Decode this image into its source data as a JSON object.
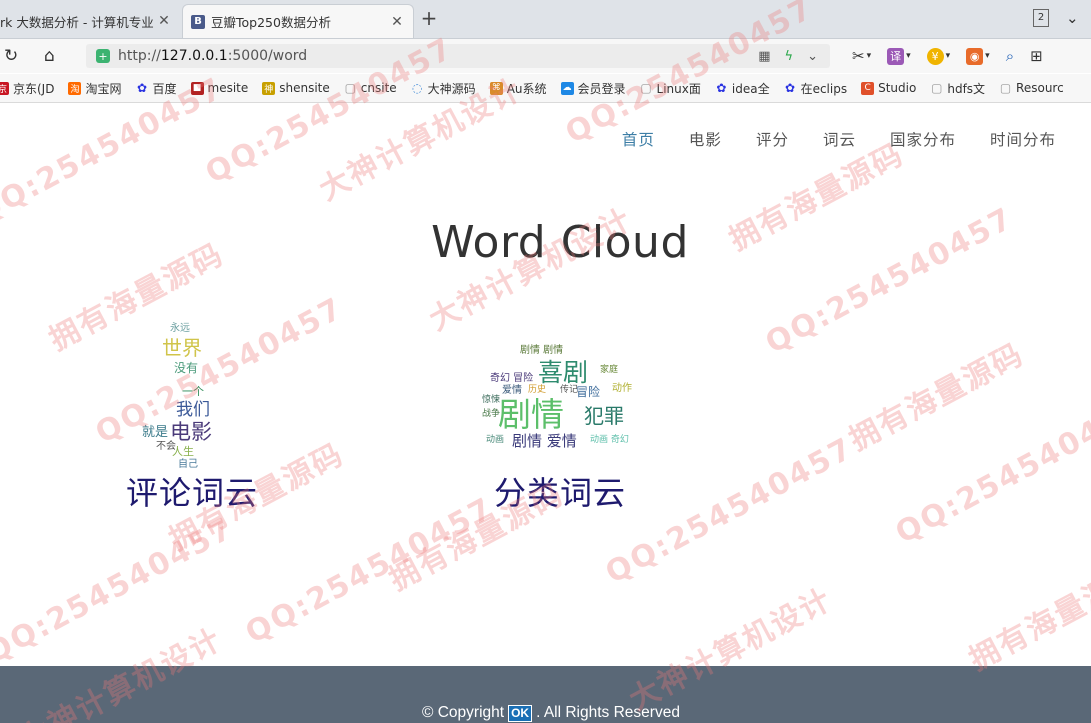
{
  "browser": {
    "tabs": [
      {
        "title": "rk 大数据分析 - 计算机专业",
        "active": false
      },
      {
        "title": "豆瓣Top250数据分析",
        "active": true,
        "favicon": "B"
      }
    ],
    "tab_count": "2",
    "url_prefix": "http://",
    "url_host": "127.0.0.1",
    "url_path": ":5000/word",
    "bookmarks": [
      {
        "label": "京东(JD",
        "icon": "jd-icon",
        "color": "#c81623"
      },
      {
        "label": "淘宝网",
        "icon": "taobao-icon",
        "color": "#ff6a00"
      },
      {
        "label": "百度",
        "icon": "baidu-paw-icon",
        "color": "#2932e1"
      },
      {
        "label": "mesite",
        "icon": "mesite-icon",
        "color": "#b22222"
      },
      {
        "label": "shensite",
        "icon": "shensite-icon",
        "color": "#c8a000"
      },
      {
        "label": "cnsite",
        "icon": "page-icon",
        "color": "#999999"
      },
      {
        "label": "大神源码",
        "icon": "globe-icon",
        "color": "#4a90d9"
      },
      {
        "label": "Au系统",
        "icon": "au-icon",
        "color": "#d98b2a"
      },
      {
        "label": "会员登录",
        "icon": "cloud-icon",
        "color": "#1e88e5"
      },
      {
        "label": "Linux面",
        "icon": "page-icon",
        "color": "#999999"
      },
      {
        "label": "idea全",
        "icon": "baidu-paw-icon",
        "color": "#2932e1"
      },
      {
        "label": "在eclips",
        "icon": "baidu-paw-icon",
        "color": "#2932e1"
      },
      {
        "label": "Studio",
        "icon": "studio-icon",
        "color": "#e0502a"
      },
      {
        "label": "hdfs文",
        "icon": "page-icon",
        "color": "#999999"
      },
      {
        "label": "Resourc",
        "icon": "page-icon",
        "color": "#999999"
      }
    ]
  },
  "nav": {
    "items": [
      "首页",
      "电影",
      "评分",
      "词云",
      "国家分布",
      "时间分布"
    ],
    "active_index": 0
  },
  "page_title": "Word Cloud",
  "clouds": [
    {
      "caption": "评论词云",
      "words": [
        "永远",
        "世界",
        "我们",
        "电影",
        "就是",
        "不会",
        "人生",
        "自己",
        "一个",
        "没有"
      ]
    },
    {
      "caption": "分类词云",
      "words": [
        "剧情 剧情",
        "喜剧",
        "奇幻 冒险",
        "剧情",
        "犯罪",
        "冒险",
        "爱情",
        "剧情 爱情",
        "动画",
        "动作",
        "传记",
        "惊悚",
        "战争",
        "家庭",
        "历史",
        "动画 奇幻"
      ]
    }
  ],
  "footer": {
    "before": "© Copyright",
    "badge": "OK",
    "after": ". All Rights Reserved"
  },
  "watermarks": [
    "QQ:254540457",
    "拥有海量源码",
    "大神计算机设计"
  ]
}
